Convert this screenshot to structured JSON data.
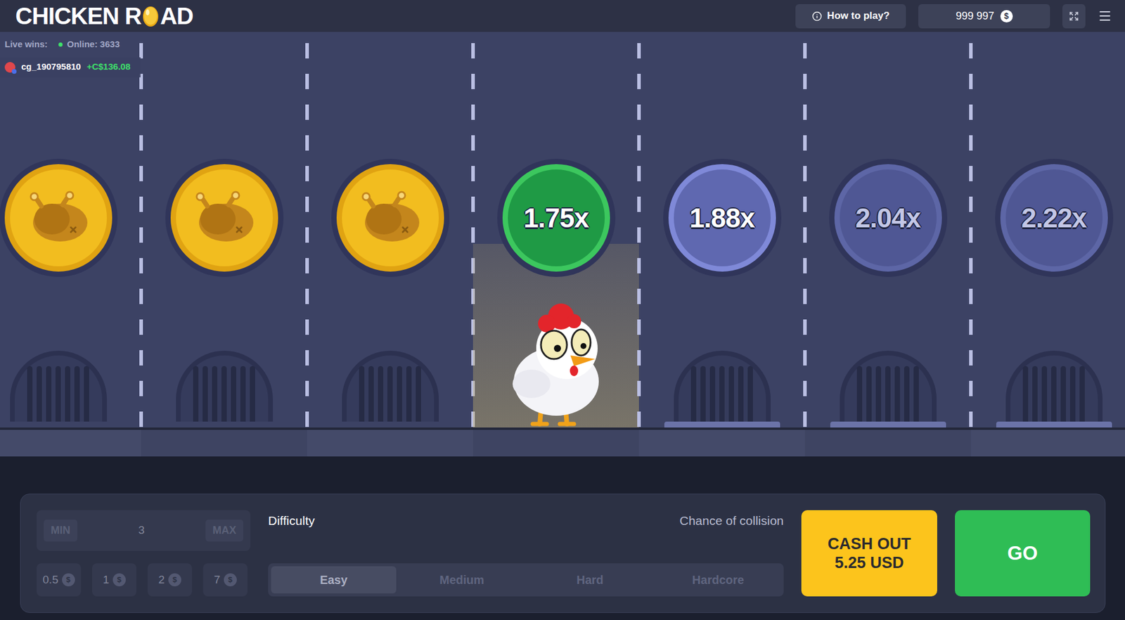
{
  "header": {
    "logo_before": "CHICKEN R",
    "logo_after": "AD",
    "how_to_play": "How to play?",
    "balance": "999 997",
    "currency": "$"
  },
  "live": {
    "label": "Live wins:",
    "online": "Online: 3633",
    "wins": [
      {
        "user": "cg_190795810",
        "amount": "+C$136.08"
      }
    ]
  },
  "lanes": [
    {
      "status": "passed"
    },
    {
      "status": "passed"
    },
    {
      "status": "passed"
    },
    {
      "status": "current",
      "multiplier": "1.75x"
    },
    {
      "status": "next",
      "multiplier": "1.88x"
    },
    {
      "status": "locked",
      "multiplier": "2.04x"
    },
    {
      "status": "locked",
      "multiplier": "2.22x"
    }
  ],
  "controls": {
    "bet": {
      "disabled": true,
      "min": "MIN",
      "value": "3",
      "max": "MAX",
      "presets": [
        {
          "value": "0.5",
          "currency": "$"
        },
        {
          "value": "1",
          "currency": "$"
        },
        {
          "value": "2",
          "currency": "$"
        },
        {
          "value": "7",
          "currency": "$"
        }
      ]
    },
    "difficulty": {
      "label": "Difficulty",
      "chance_label": "Chance of collision",
      "disabled": true,
      "options": [
        {
          "label": "Easy",
          "selected": true
        },
        {
          "label": "Medium",
          "selected": false
        },
        {
          "label": "Hard",
          "selected": false
        },
        {
          "label": "Hardcore",
          "selected": false
        }
      ]
    },
    "cash_out": {
      "label": "CASH OUT",
      "amount": "5.25 USD"
    },
    "go": "GO"
  }
}
